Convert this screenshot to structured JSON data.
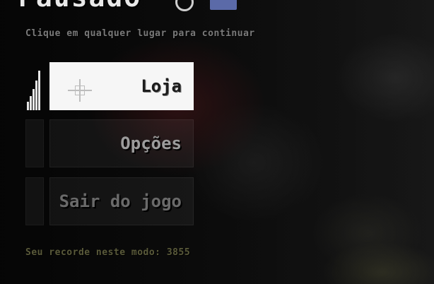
{
  "header": {
    "title": "Pausado",
    "share_icon": "share-icon",
    "facebook_icon": "facebook-icon"
  },
  "hint_text": "Clique em qualquer lugar para continuar",
  "menu": {
    "items": [
      {
        "label": "Loja",
        "selected": true
      },
      {
        "label": "Opções",
        "selected": false
      },
      {
        "label": "Sair do jogo",
        "selected": false
      }
    ]
  },
  "record_text": "Seu recorde neste modo: 3855",
  "colors": {
    "selected_bg": "#f6f6f6",
    "button_bg": "#1a1a1a",
    "facebook_blue": "#5b6aa8"
  }
}
